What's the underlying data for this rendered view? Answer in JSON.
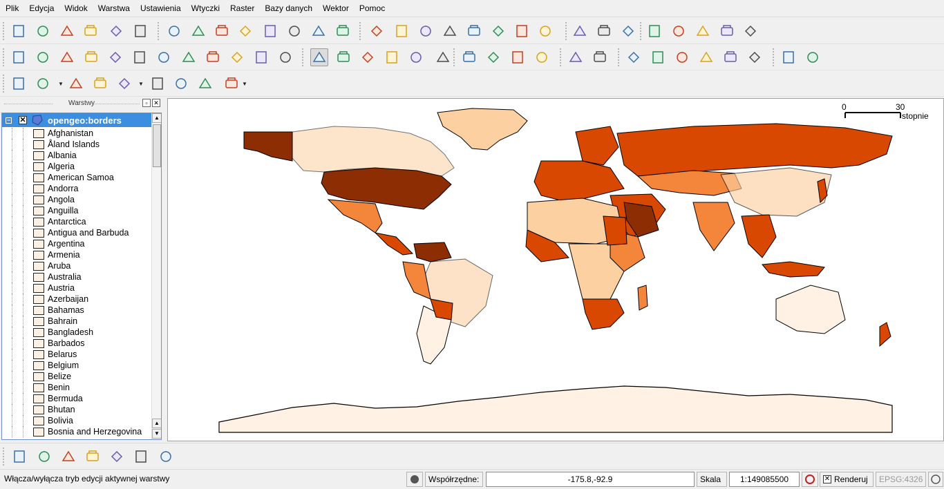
{
  "menu": [
    "Plik",
    "Edycja",
    "Widok",
    "Warstwa",
    "Ustawienia",
    "Wtyczki",
    "Raster",
    "Bazy danych",
    "Wektor",
    "Pomoc"
  ],
  "toolbar_row1": [
    "new-project-icon",
    "open-project-icon",
    "save-project-icon",
    "save-as-icon",
    "print-composer-icon",
    "print-icon",
    "add-vector-layer-icon",
    "add-raster-layer-icon",
    "add-postgis-icon",
    "add-spatialite-icon",
    "add-wms-icon",
    "add-wfs-icon",
    "remove-layer-icon",
    "new-layer-icon",
    "toggle-editing-icon",
    "save-edits-icon",
    "move-feature-icon",
    "node-tool-icon",
    "delete-selected-icon",
    "cut-features-icon",
    "copy-features-icon",
    "paste-features-icon",
    "open-toolbar-icon",
    "add-feature-icon",
    "split-features-icon",
    "digitize-icon",
    "merge-icon",
    "simplify-icon",
    "reshape-icon",
    "offset-icon"
  ],
  "toolbar_row2": [
    "undo-icon",
    "redo-icon",
    "add-ring-icon",
    "fill-ring-icon",
    "add-part-icon",
    "delete-ring-icon",
    "delete-part-icon",
    "reshape-features-icon",
    "offset-curve-icon",
    "rotate-feature-icon",
    "split-parts-icon",
    "rotate-icon",
    "pan-icon",
    "zoom-in-icon",
    "zoom-out-icon",
    "zoom-full-icon",
    "zoom-layer-icon",
    "more-icon",
    "spell-check-icon",
    "move-label-icon",
    "rotate-label-icon",
    "change-label-icon",
    "plugin-icon",
    "whats-this-icon",
    "new-bookmark-icon",
    "identify-bookmark-icon",
    "show-bookmarks-icon",
    "remove-bookmark-icon",
    "manage-bookmarks-icon",
    "refresh-bookmarks-icon",
    "measure-profile-icon",
    "histogram-icon"
  ],
  "toolbar_row3": [
    "identify-icon",
    "select-features-icon",
    "deselect-icon",
    "attribute-table-icon",
    "measure-line-icon",
    "map-tips-icon",
    "new-bookmark-hot-icon",
    "show-home-icon",
    "text-annotation-icon"
  ],
  "layers_panel": {
    "title": "Warstwy",
    "layer_name": "opengeo:borders",
    "items": [
      "Afghanistan",
      "Åland Islands",
      "Albania",
      "Algeria",
      "American Samoa",
      "Andorra",
      "Angola",
      "Anguilla",
      "Antarctica",
      "Antigua and Barbuda",
      "Argentina",
      "Armenia",
      "Aruba",
      "Australia",
      "Austria",
      "Azerbaijan",
      "Bahamas",
      "Bahrain",
      "Bangladesh",
      "Barbados",
      "Belarus",
      "Belgium",
      "Belize",
      "Benin",
      "Bermuda",
      "Bhutan",
      "Bolivia",
      "Bosnia and Herzegovina"
    ]
  },
  "scalebar": {
    "zero": "0",
    "max": "30",
    "unit": "stopnie"
  },
  "bottom_toolbar": [
    "d2s-icon",
    "globe-icon",
    "leaf-icon",
    "ruler-icon",
    "pen-icon",
    "car-icon",
    "image-icon"
  ],
  "statusbar": {
    "message": "Włącza/wyłącza tryb edycji aktywnej warstwy",
    "coord_label": "Współrzędne:",
    "coord_value": "-175.8,-92.9",
    "scale_label": "Skala",
    "scale_value": "1:149085500",
    "render_label": "Renderuj",
    "crs": "EPSG:4326"
  },
  "colors": {
    "choropleth": [
      "#fff1e4",
      "#fdd0a2",
      "#f4863c",
      "#d94801",
      "#8c2d04"
    ],
    "layer_highlight": "#3c8fe0"
  }
}
